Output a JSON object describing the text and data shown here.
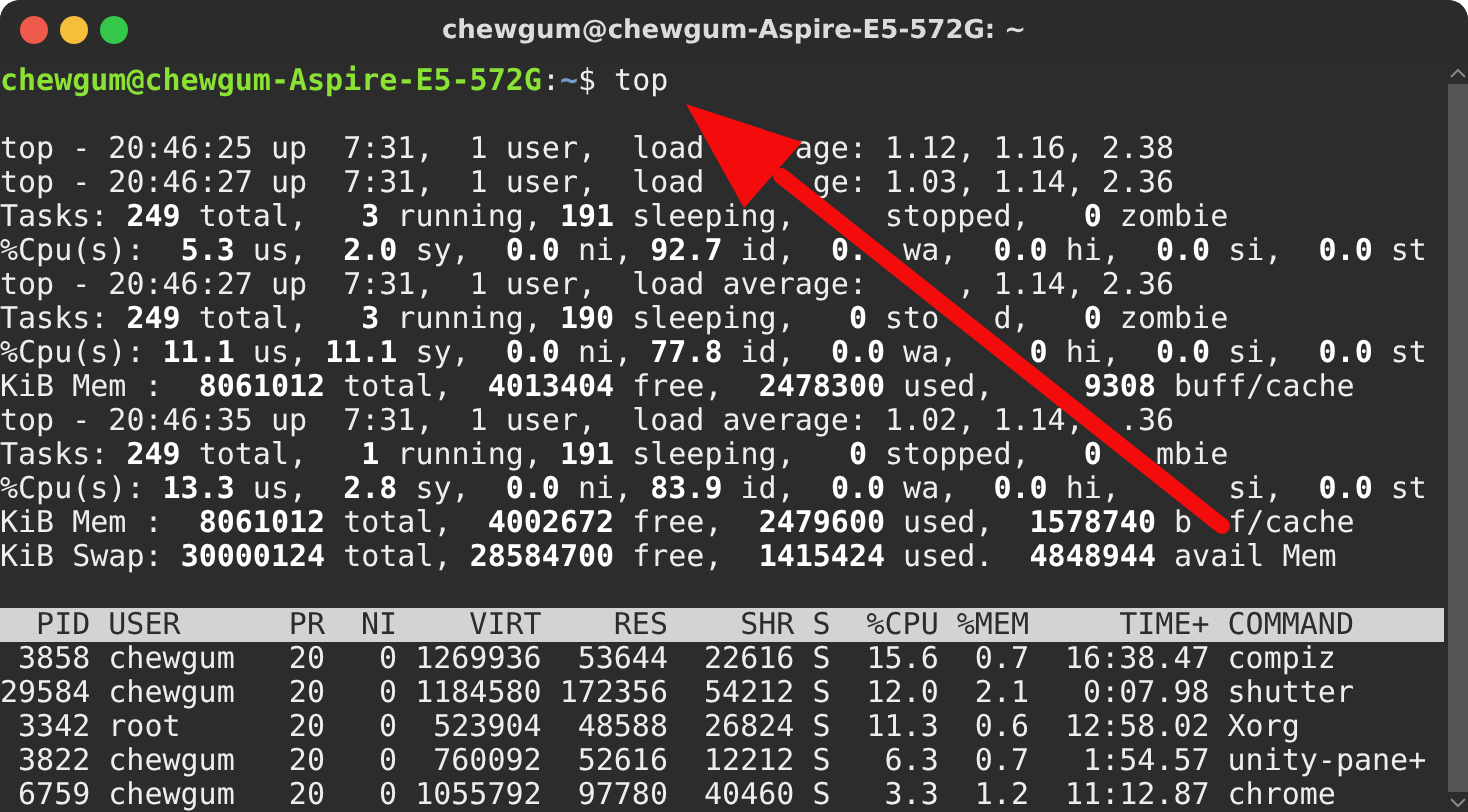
{
  "window": {
    "title": "chewgum@chewgum-Aspire-E5-572G: ~"
  },
  "prompt": {
    "user_host": "chewgum@chewgum-Aspire-E5-572G",
    "separator": ":",
    "path": "~",
    "symbol": "$",
    "command": "top"
  },
  "summary_lines": [
    "top - 20:46:25 up  7:31,  1 user,  load     age: 1.12, 1.16, 2.38",
    "top - 20:46:27 up  7:31,  1 user,  load      ge: 1.03, 1.14, 2.36",
    "Tasks: **249** total,   **3** running, **191** sleeping,     stopped,   **0** zombie",
    "%Cpu(s):  **5.3** us,  **2.0** sy,  **0.0** ni, **92.7** id,  **0.**  wa,  **0.0** hi,  **0.0** si,  **0.0** st",
    "top - 20:46:27 up  7:31,  1 user,  load average:     , 1.14, 2.36",
    "Tasks: **249** total,   **3** running, **190** sleeping,   **0** sto   d,   **0** zombie",
    "%Cpu(s): **11.1** us, **11.1** sy,  **0.0** ni, **77.8** id,  **0.0** wa,    **0** hi,  **0.0** si,  **0.0** st",
    "KiB Mem :  **8061012** total,  **4013404** free,  **2478300** used,     **9308** buff/cache",
    "top - 20:46:35 up  7:31,  1 user,  load average: 1.02, 1.14,  .36",
    "Tasks: **249** total,   **1** running, **191** sleeping,   **0** stopped,   **0**   mbie",
    "%Cpu(s): **13.3** us,  **2.8** sy,  **0.0** ni, **83.9** id,  **0.0** wa,  **0.0** hi,      si,  **0.0** st",
    "KiB Mem :  **8061012** total,  **4002672** free,  **2479600** used,  **1578740** b  f/cache",
    "KiB Swap: **30000124** total, **28584700** free,  **1415424** used.  **4848944** avail Mem"
  ],
  "table": {
    "columns": [
      "PID",
      "USER",
      "PR",
      "NI",
      "VIRT",
      "RES",
      "SHR",
      "S",
      "%CPU",
      "%MEM",
      "TIME+",
      "COMMAND"
    ],
    "rows": [
      {
        "cells": [
          "3858",
          "chewgum",
          "20",
          "0",
          "1269936",
          "53644",
          "22616",
          "S",
          "15.6",
          "0.7",
          "16:38.47",
          "compiz"
        ]
      },
      {
        "cells": [
          "29584",
          "chewgum",
          "20",
          "0",
          "1184580",
          "172356",
          "54212",
          "S",
          "12.0",
          "2.1",
          "0:07.98",
          "shutter"
        ]
      },
      {
        "cells": [
          "3342",
          "root",
          "20",
          "0",
          "523904",
          "48588",
          "26824",
          "S",
          "11.3",
          "0.6",
          "12:58.02",
          "Xorg"
        ]
      },
      {
        "cells": [
          "3822",
          "chewgum",
          "20",
          "0",
          "760092",
          "52616",
          "12212",
          "S",
          "6.3",
          "0.7",
          "1:54.57",
          "unity-pane+"
        ]
      },
      {
        "cells": [
          "6759",
          "chewgum",
          "20",
          "0",
          "1055792",
          "97780",
          "40460",
          "S",
          "3.3",
          "1.2",
          "11:12.87",
          "chrome"
        ]
      }
    ]
  }
}
